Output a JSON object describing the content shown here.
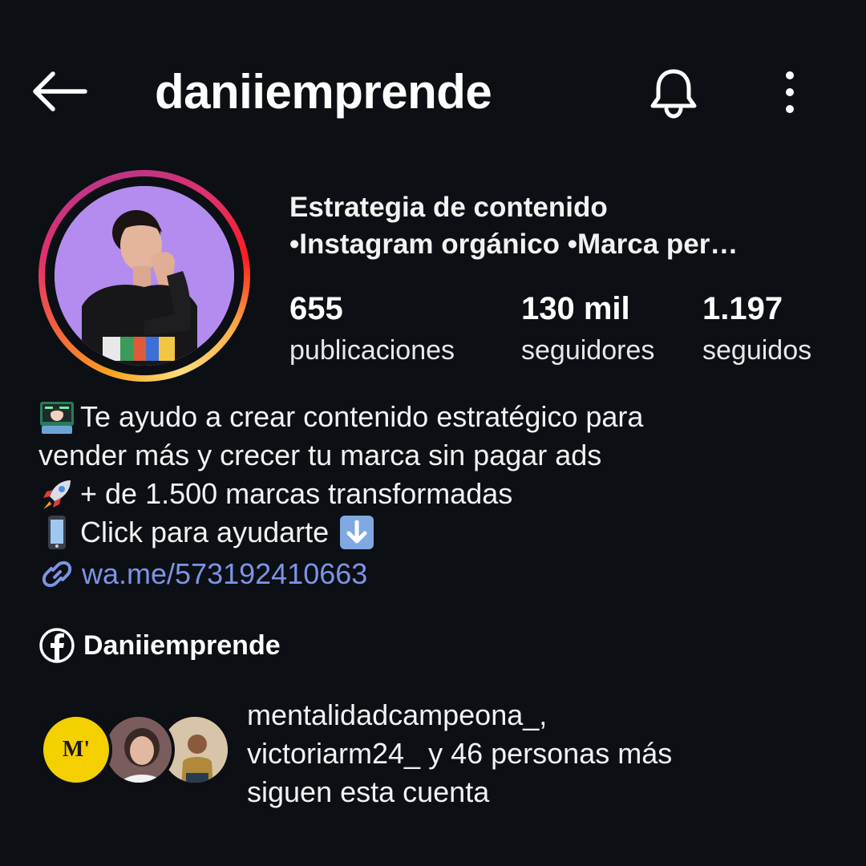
{
  "header": {
    "username": "daniiemprende",
    "back_icon": "arrow-left-icon",
    "bell_icon": "bell-icon",
    "more_icon": "more-vertical-icon"
  },
  "profile": {
    "category_line1": "Estrategia de contenido",
    "category_line2": "•Instagram orgánico •Marca per…",
    "stats": {
      "posts_count": "655",
      "posts_label": "publicaciones",
      "followers_count": "130 mil",
      "followers_label": "seguidores",
      "following_count": "1.197",
      "following_label": "seguidos"
    }
  },
  "bio": {
    "line1": "Te ayudo a crear contenido estratégico para",
    "line2": "vender más y crecer tu marca sin pagar ads",
    "line3": "+ de 1.500 marcas transformadas",
    "line4": "Click para ayudarte",
    "link": "wa.me/573192410663",
    "icons": [
      "technologist-emoji-icon",
      "rocket-emoji-icon",
      "mobile-phone-emoji-icon",
      "down-arrow-emoji-icon",
      "link-icon"
    ]
  },
  "facebook": {
    "name": "Daniiemprende",
    "icon": "facebook-icon"
  },
  "mutual": {
    "badge_text": "M'",
    "line1": "mentalidadcampeona_,",
    "line2": "victoriarm24_ y 46 personas más",
    "line3": "siguen esta cuenta"
  },
  "colors": {
    "background": "#0c0f14",
    "link": "#7d93e6",
    "badge_yellow": "#f5d000"
  }
}
